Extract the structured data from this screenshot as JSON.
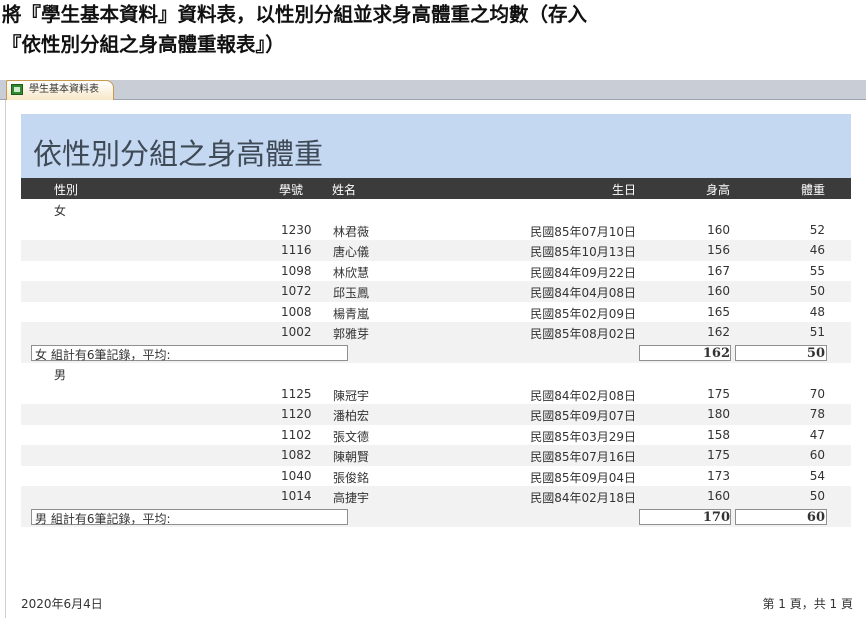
{
  "instruction": {
    "line1": "將『學生基本資料』資料表，以性別分組並求身高體重之均數（存入",
    "line2": "『依性別分組之身高體重報表』）"
  },
  "tab": {
    "label": "學生基本資料表"
  },
  "report": {
    "title": "依性別分組之身高體重",
    "columns": {
      "gender": "性別",
      "id": "學號",
      "name": "姓名",
      "birthday": "生日",
      "height": "身高",
      "weight": "體重"
    },
    "groups": [
      {
        "gender": "女",
        "rows": [
          {
            "id": "1230",
            "name": "林君薇",
            "birthday": "民國85年07月10日",
            "height": "160",
            "weight": "52"
          },
          {
            "id": "1116",
            "name": "唐心儀",
            "birthday": "民國85年10月13日",
            "height": "156",
            "weight": "46"
          },
          {
            "id": "1098",
            "name": "林欣慧",
            "birthday": "民國84年09月22日",
            "height": "167",
            "weight": "55"
          },
          {
            "id": "1072",
            "name": "邱玉鳳",
            "birthday": "民國84年04月08日",
            "height": "160",
            "weight": "50"
          },
          {
            "id": "1008",
            "name": "楊青嵐",
            "birthday": "民國85年02月09日",
            "height": "165",
            "weight": "48"
          },
          {
            "id": "1002",
            "name": "郭雅芽",
            "birthday": "民國85年08月02日",
            "height": "162",
            "weight": "51"
          }
        ],
        "summary": {
          "label": "女 組計有6筆記錄，平均:",
          "height": "162",
          "weight": "50"
        }
      },
      {
        "gender": "男",
        "rows": [
          {
            "id": "1125",
            "name": "陳冠宇",
            "birthday": "民國84年02月08日",
            "height": "175",
            "weight": "70"
          },
          {
            "id": "1120",
            "name": "潘柏宏",
            "birthday": "民國85年09月07日",
            "height": "180",
            "weight": "78"
          },
          {
            "id": "1102",
            "name": "張文德",
            "birthday": "民國85年03月29日",
            "height": "158",
            "weight": "47"
          },
          {
            "id": "1082",
            "name": "陳朝賢",
            "birthday": "民國85年07月16日",
            "height": "175",
            "weight": "60"
          },
          {
            "id": "1040",
            "name": "張俊銘",
            "birthday": "民國85年09月04日",
            "height": "173",
            "weight": "54"
          },
          {
            "id": "1014",
            "name": "高捷宇",
            "birthday": "民國84年02月18日",
            "height": "160",
            "weight": "50"
          }
        ],
        "summary": {
          "label": "男 組計有6筆記錄，平均:",
          "height": "170",
          "weight": "60"
        }
      }
    ],
    "footer": {
      "date": "2020年6月4日",
      "page": "第 1 頁，共 1 頁"
    }
  }
}
